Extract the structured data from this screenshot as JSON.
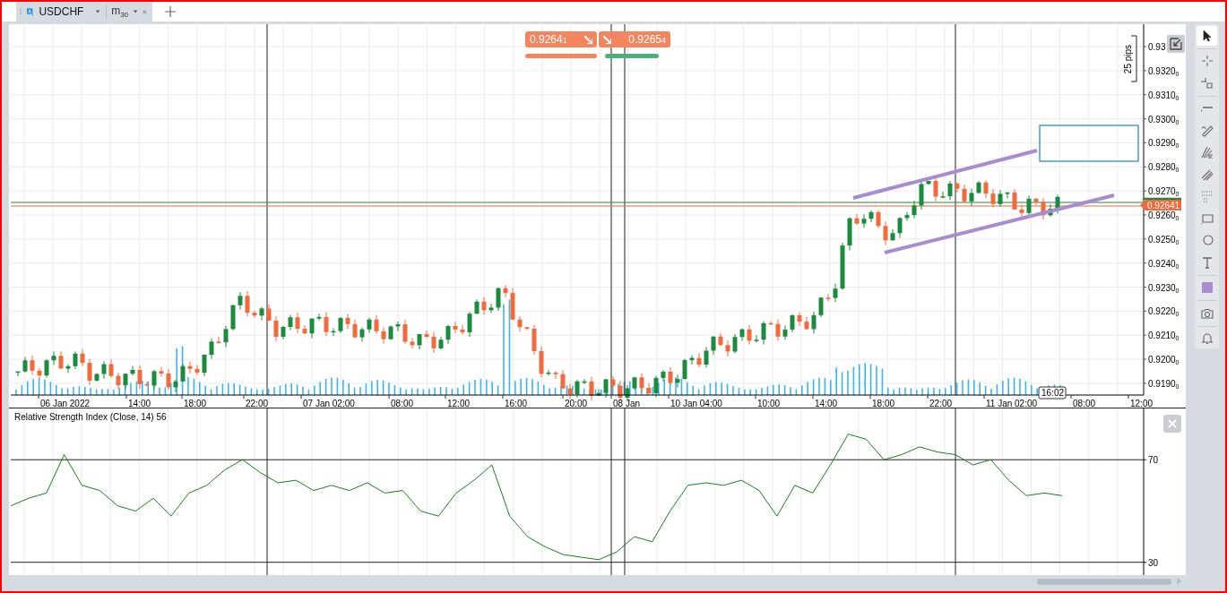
{
  "tabs": [
    {
      "symbol": "USDCHF",
      "timeframe": {
        "unit": "m",
        "value": "30"
      },
      "selected": true
    }
  ],
  "trade_buttons": [
    {
      "kind": "sell",
      "price": "0.9264",
      "pip": "1"
    },
    {
      "kind": "buy",
      "price": "0.9265",
      "pip": "4"
    }
  ],
  "price_axis": {
    "labels": [
      {
        "text": "0.93"
      },
      {
        "text": "0.9320",
        "sub": "0"
      },
      {
        "text": "0.9310",
        "sub": "0"
      },
      {
        "text": "0.9300",
        "sub": "0"
      },
      {
        "text": "0.9290",
        "sub": "0"
      },
      {
        "text": "0.9280",
        "sub": "0"
      },
      {
        "text": "0.9270",
        "sub": "0"
      },
      {
        "text": "0.9260",
        "sub": "0"
      },
      {
        "text": "0.9250",
        "sub": "0"
      },
      {
        "text": "0.9240",
        "sub": "0"
      },
      {
        "text": "0.9230",
        "sub": "0"
      },
      {
        "text": "0.9220",
        "sub": "0"
      },
      {
        "text": "0.9210",
        "sub": "0"
      },
      {
        "text": "0.9200",
        "sub": "0"
      },
      {
        "text": "0.9190",
        "sub": "0"
      }
    ],
    "current_price": "0.92641"
  },
  "pips_ruler": "25 pips",
  "time_axis": [
    "06 Jan 2022",
    "14:00",
    "18:00",
    "22:00",
    "07 Jan 02:00",
    "08:00",
    "12:00",
    "16:00",
    "20:00",
    "08 Jan",
    "10 Jan 04:00",
    "10:00",
    "14:00",
    "18:00",
    "22:00",
    "11 Jan 02:00",
    "08:00",
    "12:00"
  ],
  "cursor_time": "16:02",
  "rsi": {
    "title": "Relative Strength Index (Close, 14) 56",
    "chart_data": {
      "type": "line",
      "grid": true,
      "ylim": [
        25,
        90
      ],
      "yticks": [
        30,
        70
      ],
      "series": [
        {
          "color": "#1a7f1a",
          "values": [
            52,
            55,
            57,
            72,
            60,
            58,
            52,
            50,
            55,
            48,
            57,
            60,
            66,
            70,
            65,
            61,
            62,
            58,
            60,
            58,
            61,
            57,
            58,
            50,
            48,
            57,
            62,
            68,
            48,
            40,
            36,
            33,
            32,
            31,
            34,
            40,
            38,
            50,
            60,
            61,
            60,
            62,
            58,
            48,
            60,
            57,
            68,
            80,
            78,
            70,
            72,
            75,
            73,
            72,
            68,
            70,
            62,
            56,
            57,
            56
          ]
        }
      ]
    }
  },
  "toolbar": {
    "groups": [
      [
        {
          "kind": "pointer",
          "selected": true
        }
      ],
      [
        {
          "kind": "crosshair",
          "selected": false
        },
        {
          "kind": "crosshair-box",
          "selected": false
        }
      ],
      [
        {
          "kind": "hline",
          "selected": false
        },
        {
          "kind": "pencil",
          "selected": false
        },
        {
          "kind": "fan",
          "selected": false
        },
        {
          "kind": "parallel",
          "selected": false
        },
        {
          "kind": "dotgrid",
          "selected": false
        },
        {
          "kind": "rect",
          "selected": false
        },
        {
          "kind": "circle",
          "selected": false
        },
        {
          "kind": "text",
          "selected": false
        }
      ],
      [
        {
          "kind": "swatch",
          "selected": false
        }
      ],
      [
        {
          "kind": "camera",
          "selected": false
        }
      ],
      [
        {
          "kind": "bell",
          "selected": false
        }
      ]
    ]
  }
}
